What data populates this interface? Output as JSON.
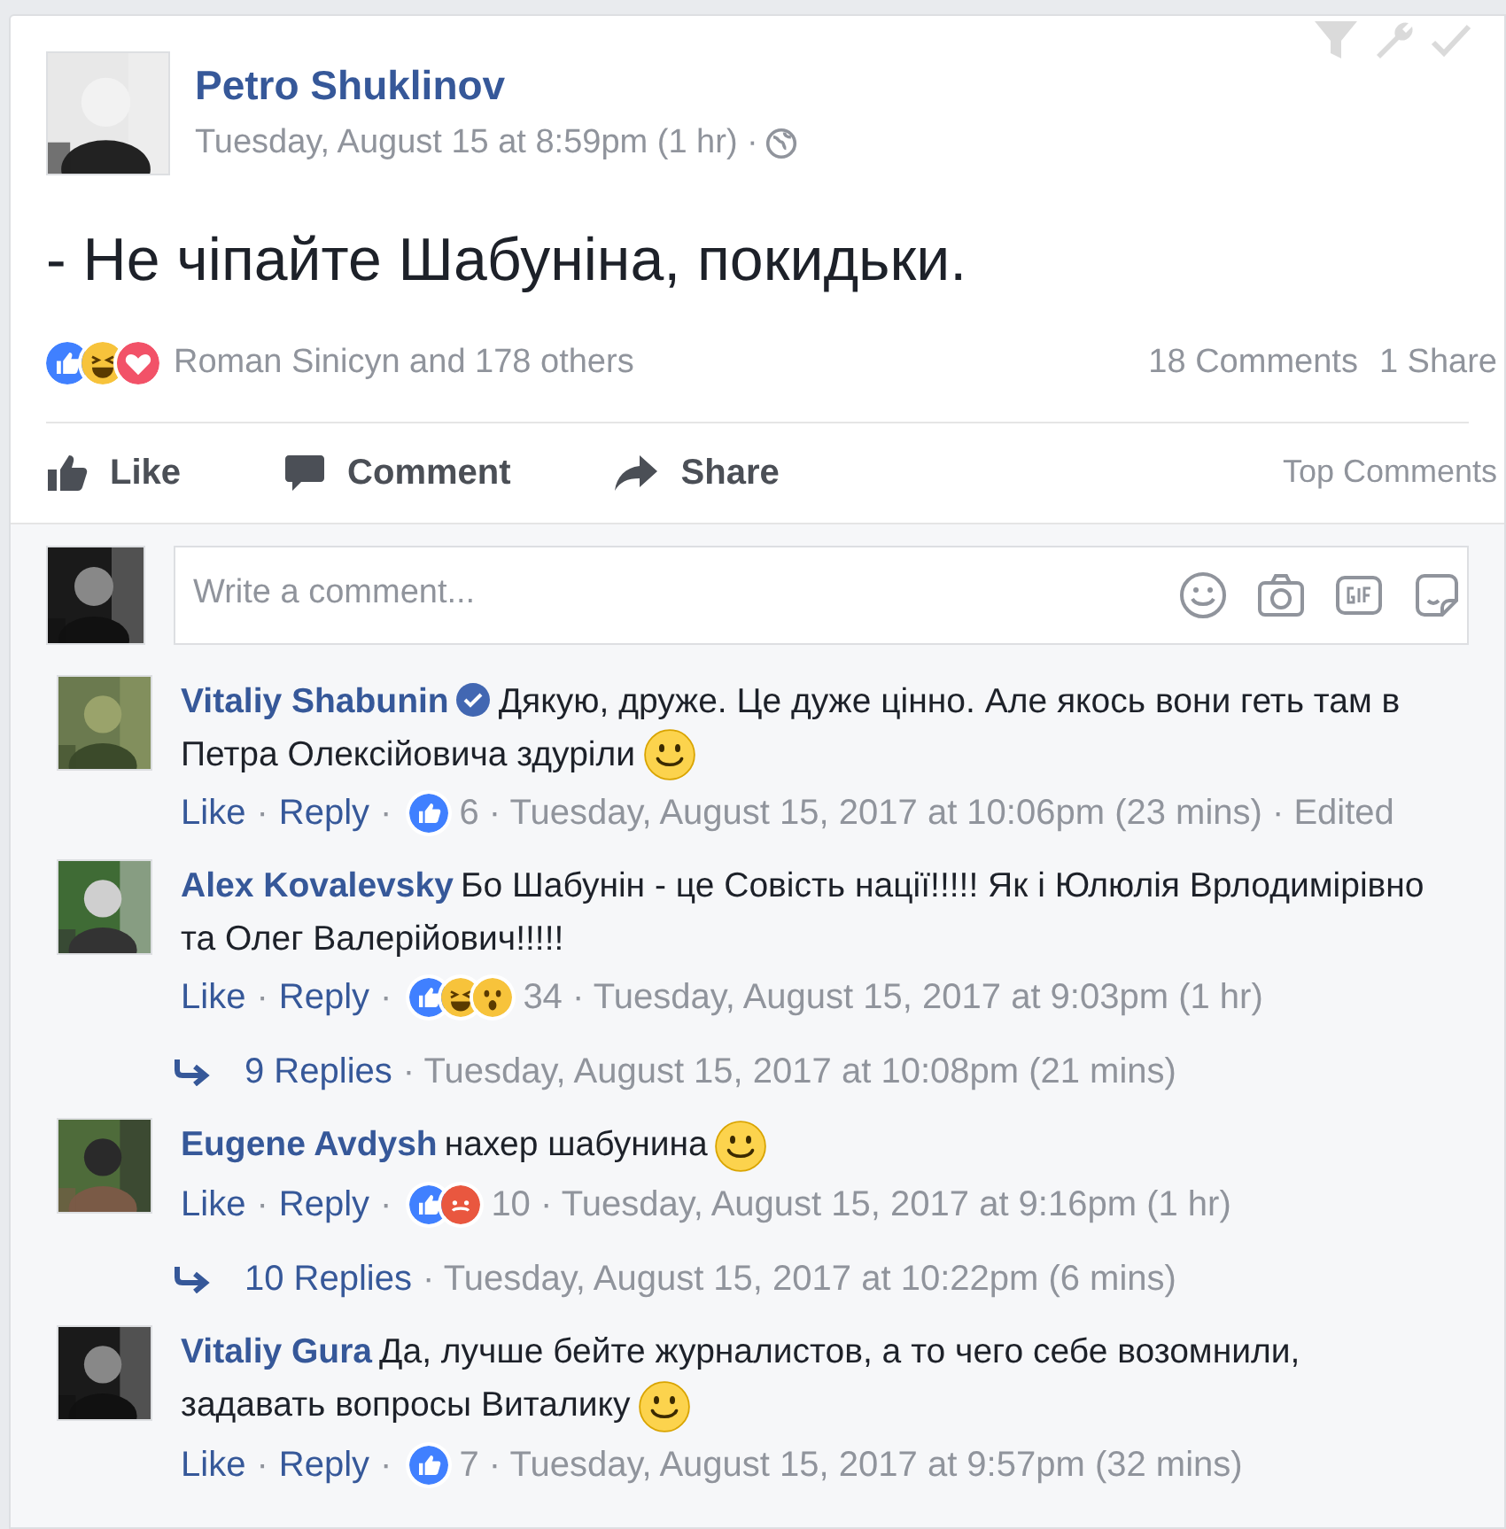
{
  "post": {
    "author": "Petro Shuklinov",
    "timestamp": "Tuesday, August 15 at 8:59pm (1 hr) ·",
    "text": "- Не чіпайте Шабуніна, покидьки.",
    "reactions": [
      {
        "kind": "like"
      },
      {
        "kind": "haha"
      },
      {
        "kind": "love"
      }
    ],
    "reactors": "Roman Sinicyn and 178 others",
    "comments_count": "18 Comments",
    "shares_count": "1 Share",
    "actions": [
      {
        "kind": "like",
        "label": "Like"
      },
      {
        "kind": "comment",
        "label": "Comment"
      },
      {
        "kind": "share",
        "label": "Share"
      }
    ],
    "sort": "Top Comments"
  },
  "composer": {
    "placeholder": "Write a comment..."
  },
  "comments": [
    {
      "kind": "comment",
      "author": "Vitaliy Shabunin",
      "verified": true,
      "text": "Дякую, друже. Це дуже цінно. Але якось вони геть там в Петра Олексійовича здуріли",
      "emoji": true,
      "meta": [
        {
          "kind": "link",
          "text": "Like"
        },
        {
          "kind": "text",
          "text": "·"
        },
        {
          "kind": "link",
          "text": "Reply"
        },
        {
          "kind": "text",
          "text": "·"
        },
        {
          "kind": "reactions",
          "reactions": [
            {
              "kind": "like"
            }
          ]
        },
        {
          "kind": "text",
          "text": "6 · Tuesday, August 15, 2017 at 10:06pm (23 mins) · Edited"
        }
      ]
    },
    {
      "kind": "comment",
      "author": "Alex Kovalevsky",
      "verified": false,
      "text": "Бо Шабунін - це Совість нації!!!!! Як і Юлюлія Врлодимірівно та Олег Валерійович!!!!!",
      "emoji": false,
      "meta": [
        {
          "kind": "link",
          "text": "Like"
        },
        {
          "kind": "text",
          "text": "·"
        },
        {
          "kind": "link",
          "text": "Reply"
        },
        {
          "kind": "text",
          "text": "·"
        },
        {
          "kind": "reactions",
          "reactions": [
            {
              "kind": "like"
            },
            {
              "kind": "haha"
            },
            {
              "kind": "wow"
            }
          ]
        },
        {
          "kind": "text",
          "text": "34 · Tuesday, August 15, 2017 at 9:03pm (1 hr)"
        }
      ]
    },
    {
      "kind": "replies",
      "link": "9 Replies",
      "text": "· Tuesday, August 15, 2017 at 10:08pm (21 mins)"
    },
    {
      "kind": "comment",
      "author": "Eugene Avdysh",
      "verified": false,
      "text": "нахер шабунина",
      "emoji": true,
      "meta": [
        {
          "kind": "link",
          "text": "Like"
        },
        {
          "kind": "text",
          "text": "·"
        },
        {
          "kind": "link",
          "text": "Reply"
        },
        {
          "kind": "text",
          "text": "·"
        },
        {
          "kind": "reactions",
          "reactions": [
            {
              "kind": "like"
            },
            {
              "kind": "angry"
            }
          ]
        },
        {
          "kind": "text",
          "text": "10 · Tuesday, August 15, 2017 at 9:16pm (1 hr)"
        }
      ]
    },
    {
      "kind": "replies",
      "link": "10 Replies",
      "text": "· Tuesday, August 15, 2017 at 10:22pm (6 mins)"
    },
    {
      "kind": "comment",
      "author": "Vitaliy Gura",
      "verified": false,
      "text": "Да, лучше бейте журналистов, а то чего себе возомнили, задавать вопросы Виталику",
      "emoji": true,
      "meta": [
        {
          "kind": "link",
          "text": "Like"
        },
        {
          "kind": "text",
          "text": "·"
        },
        {
          "kind": "link",
          "text": "Reply"
        },
        {
          "kind": "text",
          "text": "·"
        },
        {
          "kind": "reactions",
          "reactions": [
            {
              "kind": "like"
            }
          ]
        },
        {
          "kind": "text",
          "text": "7 · Tuesday, August 15, 2017 at 9:57pm (32 mins)"
        }
      ]
    }
  ]
}
